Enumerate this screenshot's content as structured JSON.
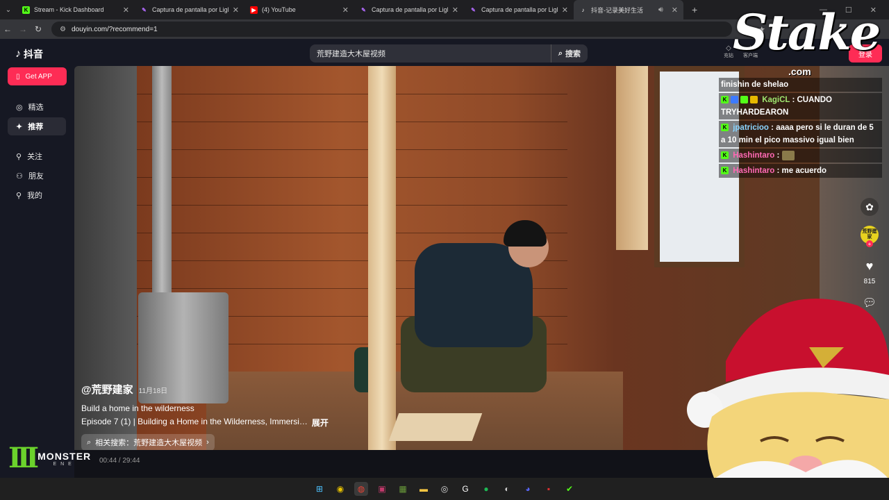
{
  "browser": {
    "tabs": [
      {
        "title": "Stream - Kick Dashboard",
        "favicon": "kick-icon",
        "color": "#53fc18"
      },
      {
        "title": "Captura de pantalla por Lightsh",
        "favicon": "lightshot-icon",
        "color": "#b36bff"
      },
      {
        "title": "(4) YouTube",
        "favicon": "youtube-icon",
        "color": "#ff0000"
      },
      {
        "title": "Captura de pantalla por Lightsh",
        "favicon": "lightshot-icon",
        "color": "#b36bff"
      },
      {
        "title": "Captura de pantalla por Lightsh",
        "favicon": "lightshot-icon",
        "color": "#b36bff"
      },
      {
        "title": "抖音-记录美好生活",
        "favicon": "douyin-icon",
        "color": "#000000",
        "active": true
      }
    ],
    "url": "douyin.com/?recommend=1"
  },
  "douyin": {
    "logo_text": "抖音",
    "get_app": "Get APP",
    "nav": [
      {
        "label": "精选",
        "icon": "compass-icon"
      },
      {
        "label": "推荐",
        "icon": "sparkle-icon",
        "selected": true
      },
      {
        "label": "关注",
        "icon": "follow-icon"
      },
      {
        "label": "朋友",
        "icon": "friends-icon"
      },
      {
        "label": "我的",
        "icon": "user-icon"
      }
    ],
    "search_text": "荒野建造大木屋视频",
    "search_button": "搜索",
    "top_right": [
      "充钻",
      "客户端"
    ],
    "login_button": "登录"
  },
  "video": {
    "author": "@荒野建家",
    "date": "11月18日",
    "desc_line1": "Build a home in the wilderness",
    "desc_line2": "Episode 7 (1) | Building a Home in the Wilderness, Immersi…",
    "expand": "展开",
    "related_search": "相关搜索：荒野建造大木屋视频",
    "avatar_text": "荒野建家",
    "likes": "815",
    "time": "00:44 / 29:44"
  },
  "chat": [
    {
      "user": "",
      "message": "finishin de shelao",
      "user_color": "#ffffff"
    },
    {
      "user": "KagiCL",
      "message": ": CUANDO TRYHARDEARON",
      "user_color": "#9fe870"
    },
    {
      "user": "jpatricioo",
      "message": ": aaaa pero si le duran de 5 a 10 min el pico massivo igual bien",
      "user_color": "#8ad4ff"
    },
    {
      "user": "Hashintaro",
      "message": ":",
      "user_color": "#ff69b4",
      "emote": true
    },
    {
      "user": "Hashintaro",
      "message": ": me acuerdo",
      "user_color": "#ff69b4"
    }
  ],
  "overlay": {
    "stake_logo": "Stake",
    "stake_domain": ".com",
    "monster_word": "MONSTER",
    "monster_sub": "ENE"
  },
  "taskbar": [
    "windows-icon",
    "norton-icon",
    "chrome-icon",
    "video-editor-icon",
    "minecraft-icon",
    "folder-icon",
    "obs-icon",
    "g-hub-icon",
    "spotify-icon",
    "steam-icon",
    "discord-icon",
    "meta-icon",
    "kick-app-icon"
  ]
}
